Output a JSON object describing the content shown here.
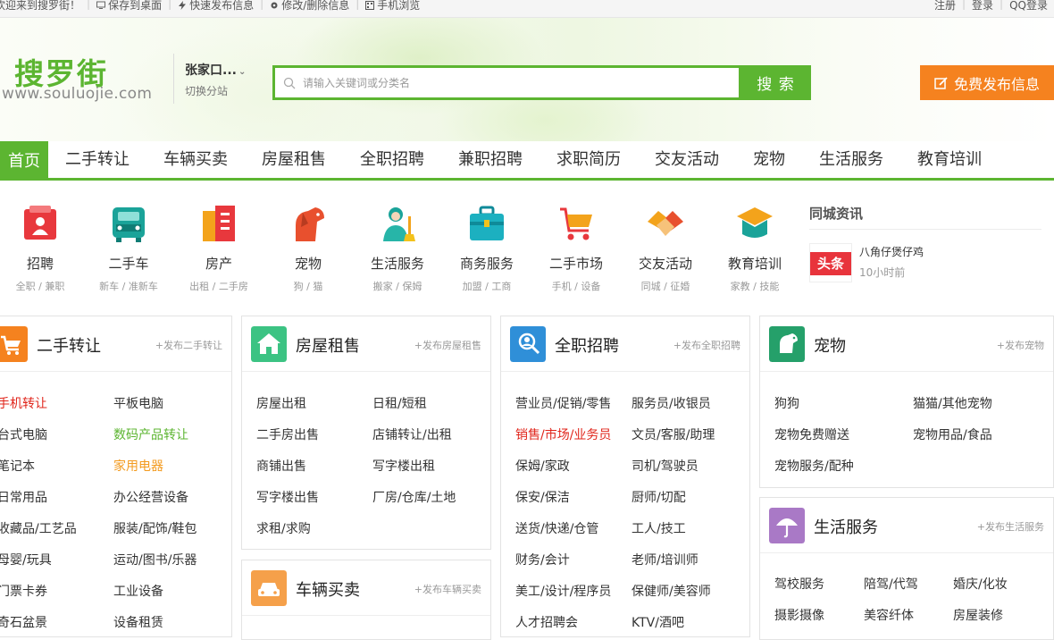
{
  "topbar": {
    "welcome": "欢迎来到搜罗街！",
    "save_desktop": "保存到桌面",
    "quick_post": "快速发布信息",
    "edit_delete": "修改/删除信息",
    "mobile_browse": "手机浏览",
    "register": "注册",
    "login": "登录",
    "qq_login": "QQ登录"
  },
  "header": {
    "logo_text": "搜罗街",
    "logo_url": "www.souluojie.com",
    "city": "张家口...",
    "switch_site": "切换分站",
    "search_placeholder": "请输入关键词或分类名",
    "search_button": "搜 索",
    "post_button": "免费发布信息"
  },
  "nav": {
    "items": [
      "首页",
      "二手转让",
      "车辆买卖",
      "房屋租售",
      "全职招聘",
      "兼职招聘",
      "求职简历",
      "交友活动",
      "宠物",
      "生活服务",
      "教育培训"
    ]
  },
  "categories": [
    {
      "name": "招聘",
      "sub": "全职 / 兼职"
    },
    {
      "name": "二手车",
      "sub": "新车 / 准新车"
    },
    {
      "name": "房产",
      "sub": "出租 / 二手房"
    },
    {
      "name": "宠物",
      "sub": "狗 / 猫"
    },
    {
      "name": "生活服务",
      "sub": "搬家 / 保姆"
    },
    {
      "name": "商务服务",
      "sub": "加盟 / 工商"
    },
    {
      "name": "二手市场",
      "sub": "手机 / 设备"
    },
    {
      "name": "交友活动",
      "sub": "同城 / 征婚"
    },
    {
      "name": "教育培训",
      "sub": "家教 / 技能"
    }
  ],
  "news": {
    "title": "同城资讯",
    "thumb_text": "头条",
    "item_title": "八角仔煲仔鸡",
    "item_time": "10小时前"
  },
  "panels": {
    "secondhand": {
      "title": "二手转让",
      "post": "+发布二手转让",
      "col1": [
        "手机转让",
        "台式电脑",
        "笔记本",
        "日常用品",
        "收藏品/工艺品",
        "母婴/玩具",
        "门票卡券",
        "奇石盆景"
      ],
      "col2": [
        "平板电脑",
        "数码产品转让",
        "家用电器",
        "办公经营设备",
        "服装/配饰/鞋包",
        "运动/图书/乐器",
        "工业设备",
        "设备租赁"
      ]
    },
    "house": {
      "title": "房屋租售",
      "post": "+发布房屋租售",
      "col1": [
        "房屋出租",
        "二手房出售",
        "商铺出售",
        "写字楼出售",
        "求租/求购"
      ],
      "col2": [
        "日租/短租",
        "店铺转让/出租",
        "写字楼出租",
        "厂房/仓库/土地"
      ]
    },
    "vehicle": {
      "title": "车辆买卖",
      "post": "+发布车辆买卖"
    },
    "jobs": {
      "title": "全职招聘",
      "post": "+发布全职招聘",
      "col1": [
        "营业员/促销/零售",
        "销售/市场/业务员",
        "保姆/家政",
        "保安/保洁",
        "送货/快递/仓管",
        "财务/会计",
        "美工/设计/程序员",
        "人才招聘会"
      ],
      "col2": [
        "服务员/收银员",
        "文员/客服/助理",
        "司机/驾驶员",
        "厨师/切配",
        "工人/技工",
        "老师/培训师",
        "保健师/美容师",
        "KTV/酒吧"
      ]
    },
    "pets": {
      "title": "宠物",
      "post": "+发布宠物",
      "col1": [
        "狗狗",
        "宠物免费赠送",
        "宠物服务/配种"
      ],
      "col2": [
        "猫猫/其他宠物",
        "宠物用品/食品"
      ]
    },
    "life": {
      "title": "生活服务",
      "post": "+发布生活服务",
      "col1": [
        "驾校服务",
        "摄影摄像"
      ],
      "col2": [
        "陪驾/代驾",
        "美容纤体"
      ],
      "col3": [
        "婚庆/化妆",
        "房屋装修"
      ]
    }
  },
  "colors": {
    "brand_green": "#5cb531",
    "post_orange": "#f5821f",
    "highlight_red": "#e0251b",
    "highlight_orange": "#f39a1e"
  }
}
